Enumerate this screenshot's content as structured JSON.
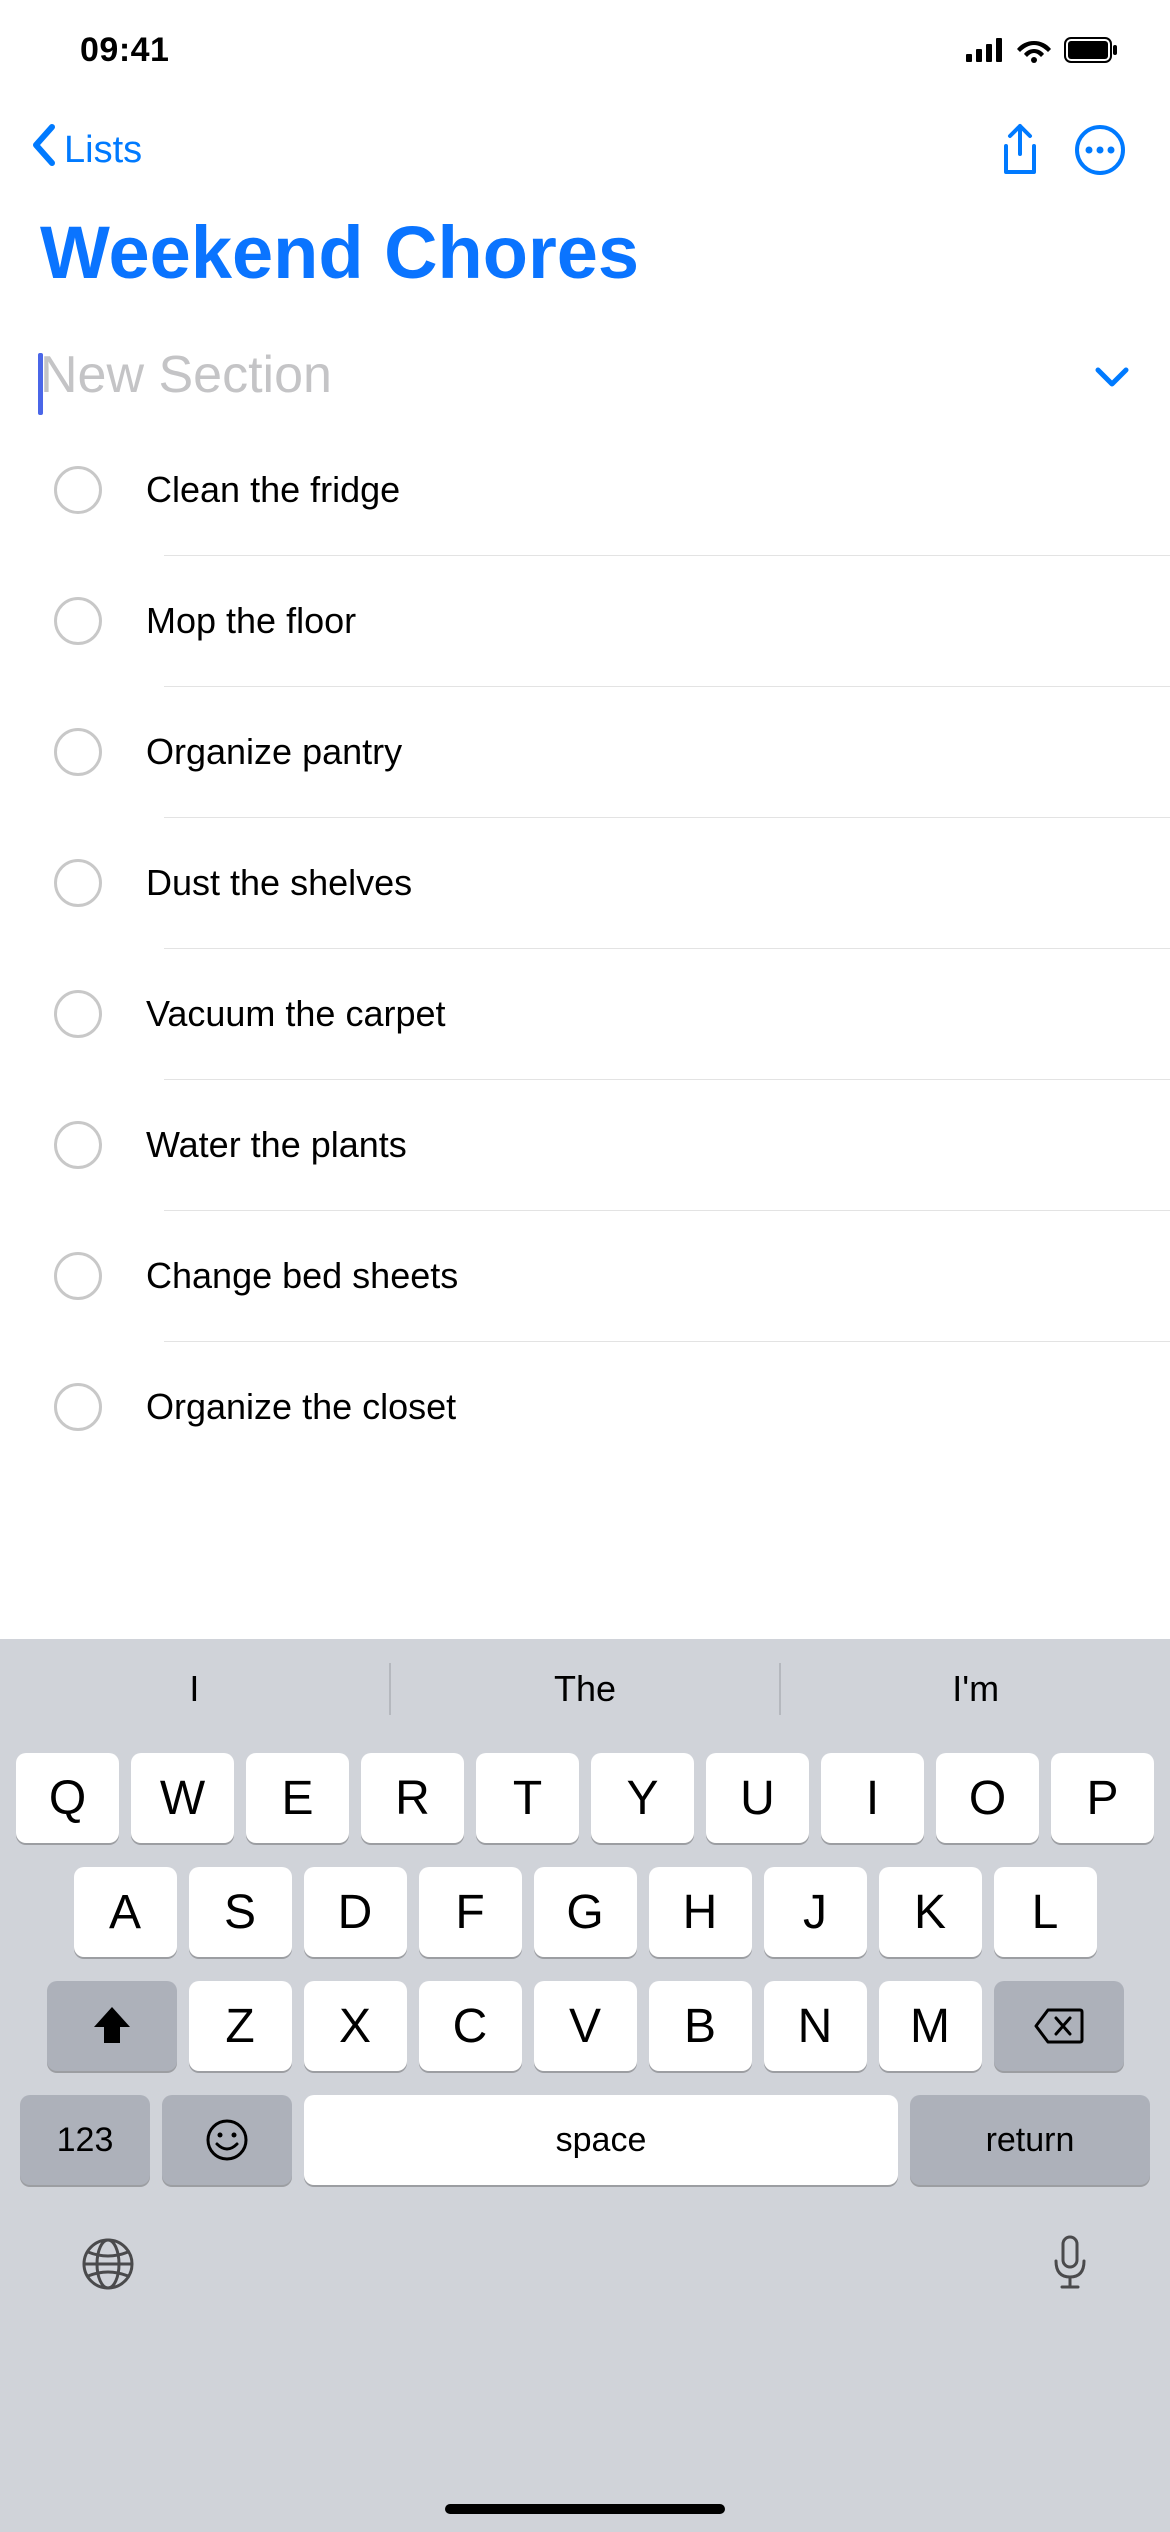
{
  "status_bar": {
    "time": "09:41"
  },
  "nav": {
    "back_label": "Lists"
  },
  "page": {
    "title": "Weekend Chores"
  },
  "section": {
    "placeholder": "New Section"
  },
  "reminders": [
    {
      "text": "Clean the fridge"
    },
    {
      "text": "Mop the floor"
    },
    {
      "text": "Organize pantry"
    },
    {
      "text": "Dust the shelves"
    },
    {
      "text": "Vacuum the carpet"
    },
    {
      "text": "Water the plants"
    },
    {
      "text": "Change bed sheets"
    },
    {
      "text": "Organize the closet"
    }
  ],
  "keyboard": {
    "suggestions": [
      "I",
      "The",
      "I'm"
    ],
    "row1": [
      "Q",
      "W",
      "E",
      "R",
      "T",
      "Y",
      "U",
      "I",
      "O",
      "P"
    ],
    "row2": [
      "A",
      "S",
      "D",
      "F",
      "G",
      "H",
      "J",
      "K",
      "L"
    ],
    "row3": [
      "Z",
      "X",
      "C",
      "V",
      "B",
      "N",
      "M"
    ],
    "numbers_label": "123",
    "space_label": "space",
    "return_label": "return"
  }
}
